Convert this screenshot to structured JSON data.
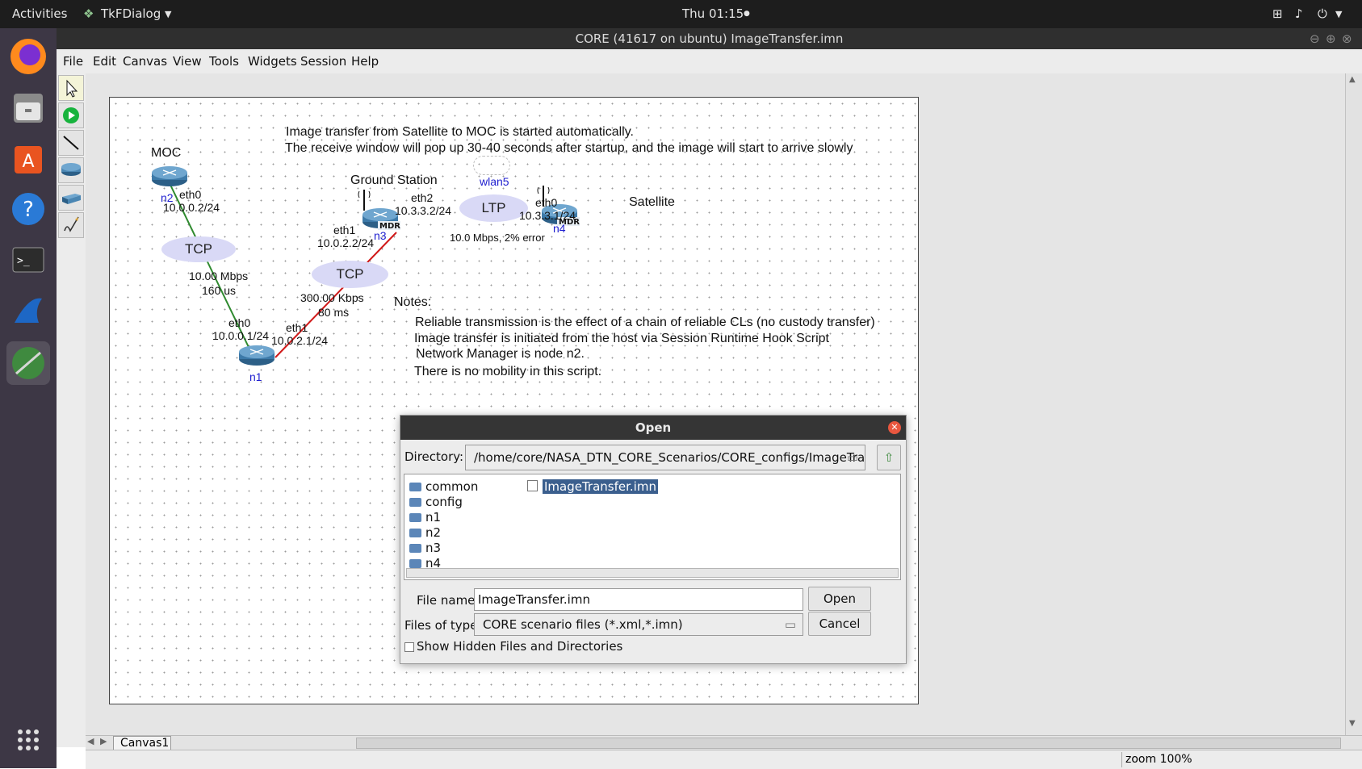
{
  "topbar": {
    "activities": "Activities",
    "app_name": "TkFDialog",
    "clock": "Thu 01:15"
  },
  "window": {
    "title": "CORE (41617 on ubuntu) ImageTransfer.imn"
  },
  "menu": [
    "File",
    "Edit",
    "Canvas",
    "View",
    "Tools",
    "Widgets",
    "Session",
    "Help"
  ],
  "toolbar": [
    "select-tool-icon",
    "start-session-icon",
    "link-tool-icon",
    "router-tool-icon",
    "switch-tool-icon",
    "annotation-tool-icon"
  ],
  "canvas": {
    "header_line1": "Image transfer from Satellite to MOC is started automatically.",
    "header_line2": "The receive window will pop up 30-40 seconds after startup, and the image will start to arrive slowly",
    "label_moc": "MOC",
    "label_ground": "Ground Station",
    "label_satellite": "Satellite",
    "wlan_name": "wlan5",
    "n2": {
      "name": "n2",
      "iface": "eth0",
      "ip": "10.0.0.2/24"
    },
    "n1": {
      "name": "n1",
      "iface0": "eth0",
      "ip0": "10.0.0.1/24",
      "iface1": "eth1",
      "ip1": "10.0.2.1/24"
    },
    "n3": {
      "name": "n3",
      "badge": "MDR",
      "iface1": "eth1",
      "ip1": "10.0.2.2/24",
      "iface2": "eth2",
      "ip2": "10.3.3.2/24"
    },
    "n4": {
      "name": "n4",
      "badge": "MDR",
      "iface": "eth0",
      "ip": "10.3.3.1/24"
    },
    "link1": {
      "label": "TCP",
      "rate": "10.00 Mbps",
      "delay": "160 us",
      "color": "#2f8a2f"
    },
    "link2": {
      "label": "TCP",
      "rate": "300.00 Kbps",
      "delay": "80 ms",
      "color": "#d01818"
    },
    "link3": {
      "label": "LTP",
      "rate_err": "10.0 Mbps, 2% error"
    },
    "notes_title": "Notes:",
    "notes": [
      "Reliable transmission is the effect of a chain of reliable CLs (no custody transfer)",
      "Image transfer is initiated from the host via Session Runtime Hook Script",
      "Network Manager is node n2.",
      "There is no mobility in this script."
    ]
  },
  "tabs": {
    "canvas1": "Canvas1"
  },
  "status": {
    "zoom": "zoom 100%"
  },
  "dialog": {
    "title": "Open",
    "directory_label": "Directory:",
    "directory_value": "/home/core/NASA_DTN_CORE_Scenarios/CORE_configs/ImageTransfer",
    "folders": [
      "common",
      "config",
      "n1",
      "n2",
      "n3",
      "n4"
    ],
    "files": [
      "ImageTransfer.imn"
    ],
    "filename_label": "File name:",
    "filename_value": "ImageTransfer.imn",
    "filetype_label": "Files of type:",
    "filetype_value": "CORE scenario files (*.xml,*.imn)",
    "open_label": "Open",
    "cancel_label": "Cancel",
    "hidden_label": "Show Hidden Files and Directories"
  }
}
